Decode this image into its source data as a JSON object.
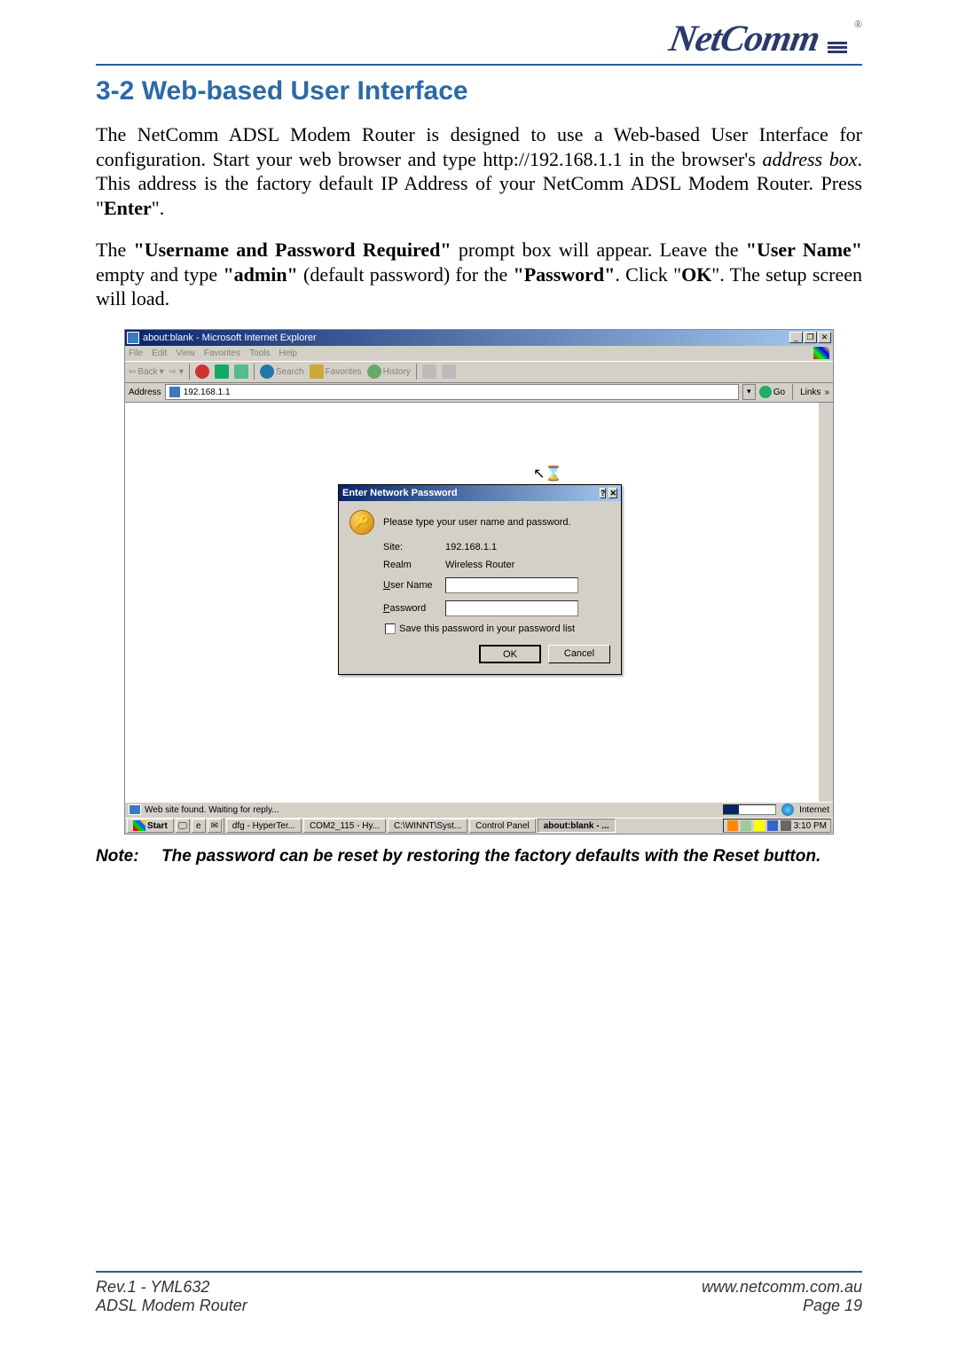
{
  "brand": {
    "name": "NetComm",
    "registered": "®"
  },
  "heading": "3-2 Web-based User Interface",
  "para1": {
    "t1": "The NetComm ADSL Modem Router is designed to use a Web-based User Interface for configuration. Start your web browser and type http://192.168.1.1 in the browser's ",
    "addrbox": "address box",
    "t2": ". This address is the factory default IP Address of your NetComm ADSL Modem Router. Press \"",
    "enter": "Enter",
    "t3": "\"."
  },
  "para2": {
    "t1": "The ",
    "b1": "\"Username and Password Required\"",
    "t2": " prompt box will appear. Leave the ",
    "b2": "\"User Name\"",
    "t3": " empty and type ",
    "b3": "\"admin\"",
    "t4": " (default password) for the ",
    "b4": "\"Password\"",
    "t5": ". Click \"",
    "b5": "OK",
    "t6": "\". The setup screen will load."
  },
  "note": {
    "label": "Note:",
    "text": "The password can be reset by restoring the factory defaults with the Reset button."
  },
  "footer": {
    "left1": "Rev.1 - YML632",
    "left2": "ADSL Modem Router",
    "right1": "www.netcomm.com.au",
    "right2": "Page 19"
  },
  "ie": {
    "title": "about:blank - Microsoft Internet Explorer",
    "menu": {
      "file": "File",
      "edit": "Edit",
      "view": "View",
      "favorites": "Favorites",
      "tools": "Tools",
      "help": "Help"
    },
    "tb": {
      "back": "Back",
      "search": "Search",
      "favorites": "Favorites",
      "history": "History"
    },
    "addr_label": "Address",
    "addr_value": "192.168.1.1",
    "go": "Go",
    "links": "Links",
    "status": "Web site found. Waiting for reply...",
    "internet": "Internet"
  },
  "dialog": {
    "title": "Enter Network Password",
    "prompt": "Please type your user name and password.",
    "site_label": "Site:",
    "site_value": "192.168.1.1",
    "realm_label": "Realm",
    "realm_value": "Wireless Router",
    "user_label_pre": "U",
    "user_label_rest": "ser Name",
    "pass_label_pre": "P",
    "pass_label_rest": "assword",
    "save_pre": "S",
    "save_rest": "ave this password in your password list",
    "ok": "OK",
    "cancel": "Cancel"
  },
  "taskbar": {
    "start": "Start",
    "tasks": [
      "dfg - HyperTer...",
      "COM2_115 - Hy...",
      "C:\\WINNT\\Syst...",
      "Control Panel",
      "about:blank - ..."
    ],
    "time": "3:10 PM"
  }
}
